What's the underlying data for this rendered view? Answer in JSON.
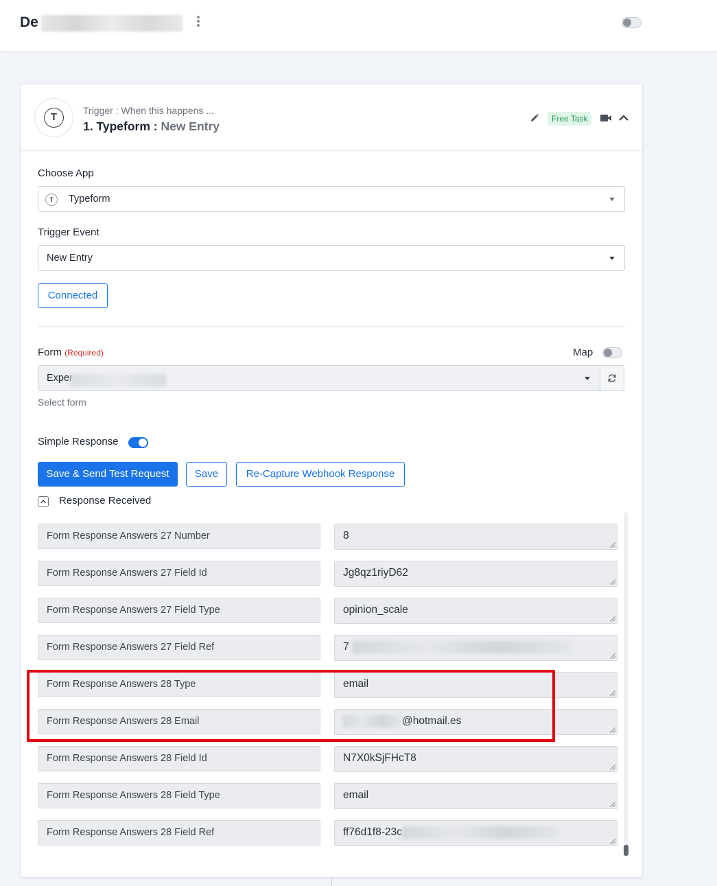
{
  "header": {
    "title_prefix": "De",
    "toggle_state": "off"
  },
  "trigger": {
    "app_initial": "T",
    "label": "Trigger : When this happens ...",
    "step": "1. Typeform : ",
    "event": "New Entry",
    "badge": "Free Task"
  },
  "choose_app": {
    "label": "Choose App",
    "value": "Typeform",
    "icon_letter": "T"
  },
  "trigger_event": {
    "label": "Trigger Event",
    "value": "New Entry"
  },
  "connection": {
    "button_label": "Connected"
  },
  "form": {
    "label": "Form",
    "required": "(Required)",
    "map_label": "Map",
    "value": "Exper",
    "hint": "Select form"
  },
  "simple_response": {
    "label": "Simple Response",
    "enabled": true
  },
  "actions": {
    "save_send": "Save & Send Test Request",
    "save": "Save",
    "recapture": "Re-Capture Webhook Response"
  },
  "response": {
    "label": "Response Received",
    "rows": [
      {
        "key": "Form Response Answers 27 Number",
        "value": "8"
      },
      {
        "key": "Form Response Answers 27 Field Id",
        "value": "Jg8qz1riyD62"
      },
      {
        "key": "Form Response Answers 27 Field Type",
        "value": "opinion_scale"
      },
      {
        "key": "Form Response Answers 27 Field Ref",
        "value": "7"
      },
      {
        "key": "Form Response Answers 28 Type",
        "value": "email"
      },
      {
        "key": "Form Response Answers 28 Email",
        "value": "@hotmail.es"
      },
      {
        "key": "Form Response Answers 28 Field Id",
        "value": "N7X0kSjFHcT8"
      },
      {
        "key": "Form Response Answers 28 Field Type",
        "value": "email"
      },
      {
        "key": "Form Response Answers 28 Field Ref",
        "value": "ff76d1f8-23c"
      }
    ]
  },
  "colors": {
    "primary": "#1a73e8",
    "highlight": "#e30613",
    "badge_bg": "#dff5e8",
    "badge_text": "#23995a",
    "required": "#d0342c"
  }
}
